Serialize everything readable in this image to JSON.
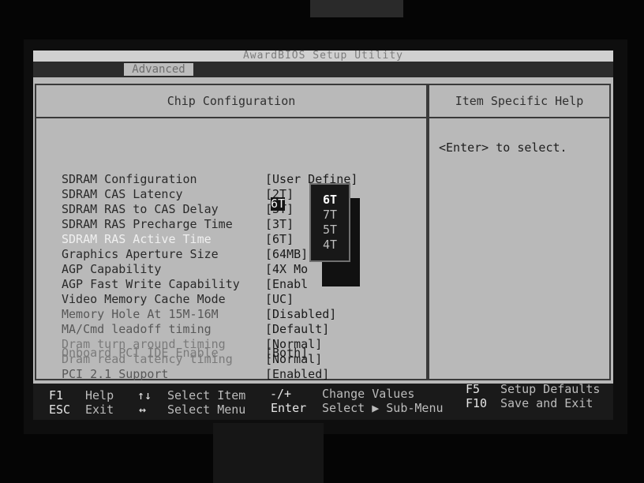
{
  "bios": {
    "title": "AwardBIOS Setup Utility",
    "active_menu": "Advanced"
  },
  "main_panel": {
    "header": "Chip Configuration",
    "items": [
      {
        "label": "SDRAM Configuration",
        "value": "[User Define]"
      },
      {
        "label": "SDRAM CAS Latency",
        "value": "[2T]"
      },
      {
        "label": "SDRAM RAS to CAS Delay",
        "value": "[3T]"
      },
      {
        "label": "SDRAM RAS Precharge Time",
        "value": "[3T]"
      },
      {
        "label": "SDRAM RAS Active Time",
        "value": "[6T]"
      },
      {
        "label": "Graphics Aperture Size",
        "value": "[64MB]"
      },
      {
        "label": "AGP Capability",
        "value": "[4X Mo"
      },
      {
        "label": "AGP Fast Write Capability",
        "value": "[Enabl"
      },
      {
        "label": "Video Memory Cache Mode",
        "value": "[UC]"
      },
      {
        "label": "Memory Hole At 15M-16M",
        "value": "[Disabled]"
      },
      {
        "label": "MA/Cmd leadoff timing",
        "value": "[Default]"
      },
      {
        "label": "Dram turn around timing",
        "value": "[Normal]"
      },
      {
        "label": "Dram read latency timing",
        "value": "[Normal]"
      },
      {
        "label": "PCI 2.1 Support",
        "value": "[Enabled]"
      },
      {
        "label": "Onboard PCI IDE Enable",
        "value": "[Both]"
      }
    ]
  },
  "help_panel": {
    "header": "Item Specific Help",
    "text": "<Enter> to select."
  },
  "popup": {
    "selected_value": "6T",
    "options": [
      "6T",
      "7T",
      "5T",
      "4T"
    ]
  },
  "footer": {
    "f1_key": "F1",
    "f1_desc": "Help",
    "esc_key": "ESC",
    "esc_desc": "Exit",
    "arrows_ud_key": "↑↓",
    "arrows_ud_desc": "Select Item",
    "arrows_lr_key": "↔",
    "arrows_lr_desc": "Select Menu",
    "plusminus_key": "-/+",
    "plusminus_desc": "Change Values",
    "enter_key": "Enter",
    "enter_desc": "Select ▶ Sub-Menu",
    "f5_key": "F5",
    "f5_desc": "Setup Defaults",
    "f10_key": "F10",
    "f10_desc": "Save and Exit"
  }
}
